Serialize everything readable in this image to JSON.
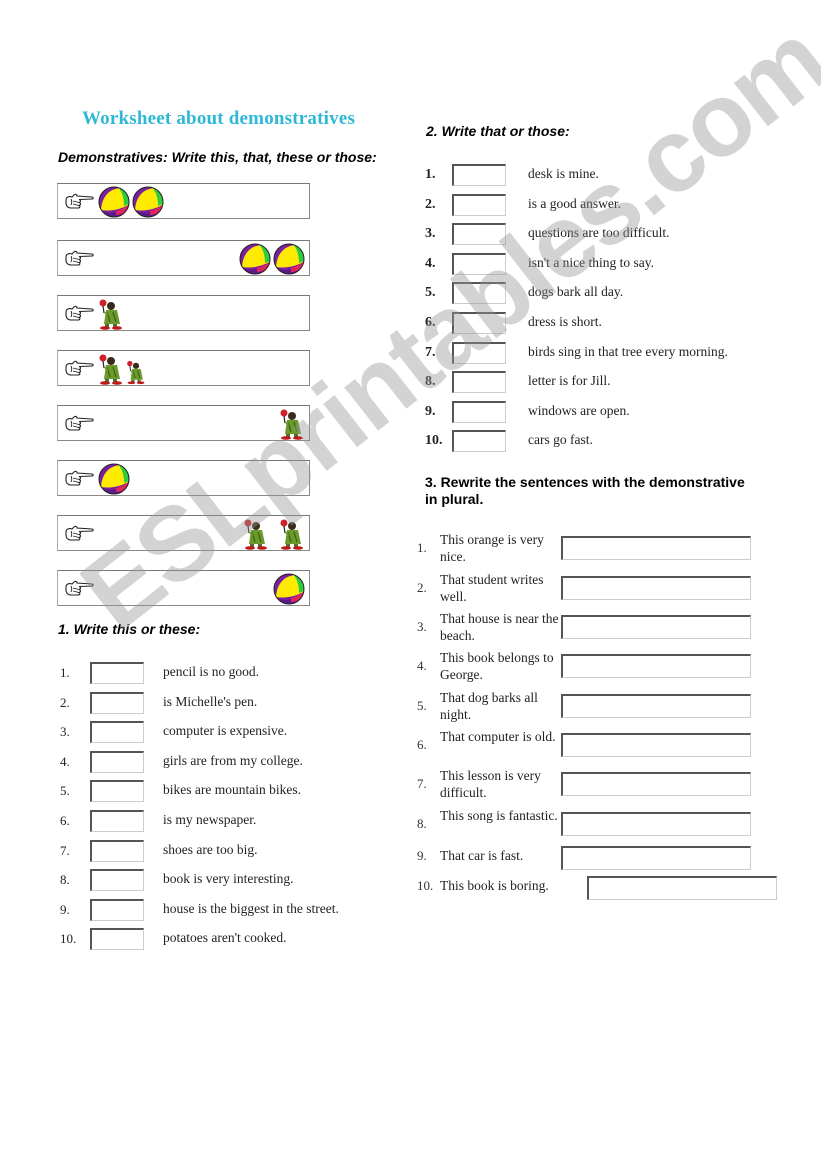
{
  "title": "Worksheet about demonstratives",
  "intro": {
    "heading": "Demonstratives: Write this, that, these or those:",
    "rows": [
      {
        "items": [
          "ball-icon",
          "ball-icon"
        ],
        "side": "left"
      },
      {
        "items": [
          "ball-icon",
          "ball-icon"
        ],
        "side": "right"
      },
      {
        "items": [
          "clown-icon"
        ],
        "side": "left"
      },
      {
        "items": [
          "clown-icon",
          "clown-small-icon"
        ],
        "side": "left"
      },
      {
        "items": [
          "clown-icon"
        ],
        "side": "right"
      },
      {
        "items": [
          "ball-icon"
        ],
        "side": "left"
      },
      {
        "items": [
          "clown-icon",
          "clown-icon"
        ],
        "side": "right"
      },
      {
        "items": [
          "ball-icon"
        ],
        "side": "right"
      }
    ]
  },
  "section1": {
    "heading": "1. Write this or these:",
    "items": [
      {
        "n": "1.",
        "text": "pencil is no good."
      },
      {
        "n": "2.",
        "text": "is  Michelle's pen."
      },
      {
        "n": "3.",
        "text": "computer is expensive."
      },
      {
        "n": "4.",
        "text": "girls are from my college."
      },
      {
        "n": "5.",
        "text": "bikes are mountain bikes."
      },
      {
        "n": "6.",
        "text": "is  my newspaper."
      },
      {
        "n": "7.",
        "text": "shoes are too big."
      },
      {
        "n": "8.",
        "text": "book is very interesting."
      },
      {
        "n": "9.",
        "text": "house is the biggest in the street."
      },
      {
        "n": "10.",
        "text": "potatoes aren't cooked."
      }
    ]
  },
  "section2": {
    "heading": "2. Write that or those:",
    "items": [
      {
        "n": "1.",
        "text": "desk is mine."
      },
      {
        "n": "2.",
        "text": "is a good answer."
      },
      {
        "n": "3.",
        "text": "questions are too difficult."
      },
      {
        "n": "4.",
        "text": "isn't a nice thing to say."
      },
      {
        "n": "5.",
        "text": "dogs bark all day."
      },
      {
        "n": "6.",
        "text": "dress is short."
      },
      {
        "n": "7.",
        "text": "birds sing in that tree every morning."
      },
      {
        "n": "8.",
        "text": "letter is for Jill."
      },
      {
        "n": "9.",
        "text": "windows are open."
      },
      {
        "n": "10.",
        "text": "cars go fast."
      }
    ]
  },
  "section3": {
    "heading_line1": "3. Rewrite the sentences with the demonstrative",
    "heading_line2": "in plural.",
    "items": [
      {
        "n": "1.",
        "text": "This orange is very nice."
      },
      {
        "n": "2.",
        "text": "That student writes well."
      },
      {
        "n": "3.",
        "text": "That house is near the beach."
      },
      {
        "n": "4.",
        "text": "This book belongs to George."
      },
      {
        "n": "5.",
        "text": "That dog barks all night."
      },
      {
        "n": "6.",
        "text": "That computer is old."
      },
      {
        "n": "7.",
        "text": "This lesson is very difficult."
      },
      {
        "n": "8.",
        "text": "This song is fantastic."
      },
      {
        "n": "9.",
        "text": "That car is fast."
      },
      {
        "n": "10.",
        "text": "This book is boring."
      }
    ]
  },
  "watermark": "ESLprintables.com",
  "colors": {
    "title": "#2fb8d6"
  }
}
